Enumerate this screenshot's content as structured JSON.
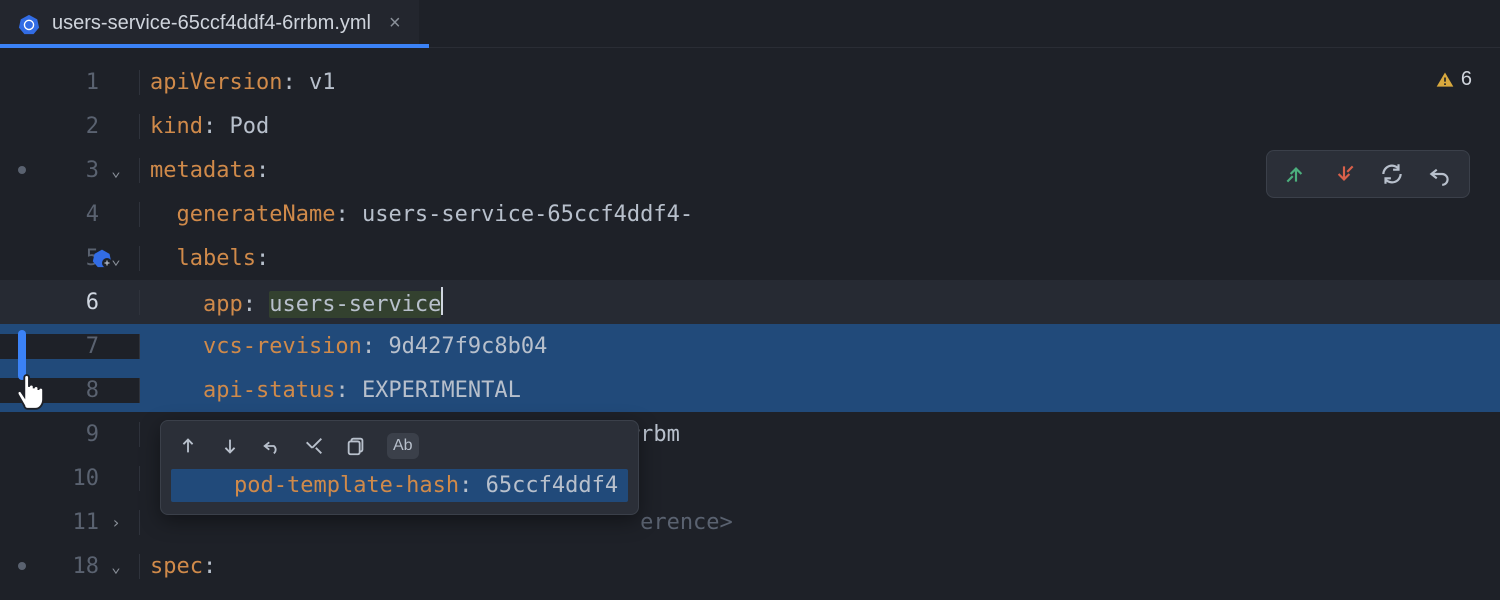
{
  "tab": {
    "filename": "users-service-65ccf4ddf4-6rrbm.yml",
    "icon": "kubernetes-icon"
  },
  "problems": {
    "count": "6"
  },
  "toolbar": {
    "items": [
      "push-icon",
      "pull-icon",
      "sync-icon",
      "rollback-icon"
    ]
  },
  "code": {
    "l1": {
      "n": "1",
      "key": "apiVersion",
      "val": "v1"
    },
    "l2": {
      "n": "2",
      "key": "kind",
      "val": "Pod"
    },
    "l3": {
      "n": "3",
      "key": "metadata"
    },
    "l4": {
      "n": "4",
      "key": "generateName",
      "val": "users-service-65ccf4ddf4-"
    },
    "l5": {
      "n": "5",
      "key": "labels"
    },
    "l6": {
      "n": "6",
      "key": "app",
      "val": "users-service"
    },
    "l7": {
      "n": "7",
      "key": "vcs-revision",
      "val": "9d427f9c8b04"
    },
    "l8": {
      "n": "8",
      "key": "api-status",
      "val": "EXPERIMENTAL"
    },
    "l9": {
      "n": "9",
      "tail": "-65ccf4ddf4-6rrbm"
    },
    "l10": {
      "n": "10"
    },
    "l11": {
      "n": "11",
      "hint": "erence>"
    },
    "l18": {
      "n": "18",
      "key": "spec"
    }
  },
  "popup": {
    "buttons": [
      "prev-icon",
      "next-icon",
      "undo-icon",
      "apply-icon",
      "copy-icon",
      "ab-toggle"
    ],
    "line": {
      "key": "pod-template-hash",
      "val": "65ccf4ddf4"
    }
  }
}
